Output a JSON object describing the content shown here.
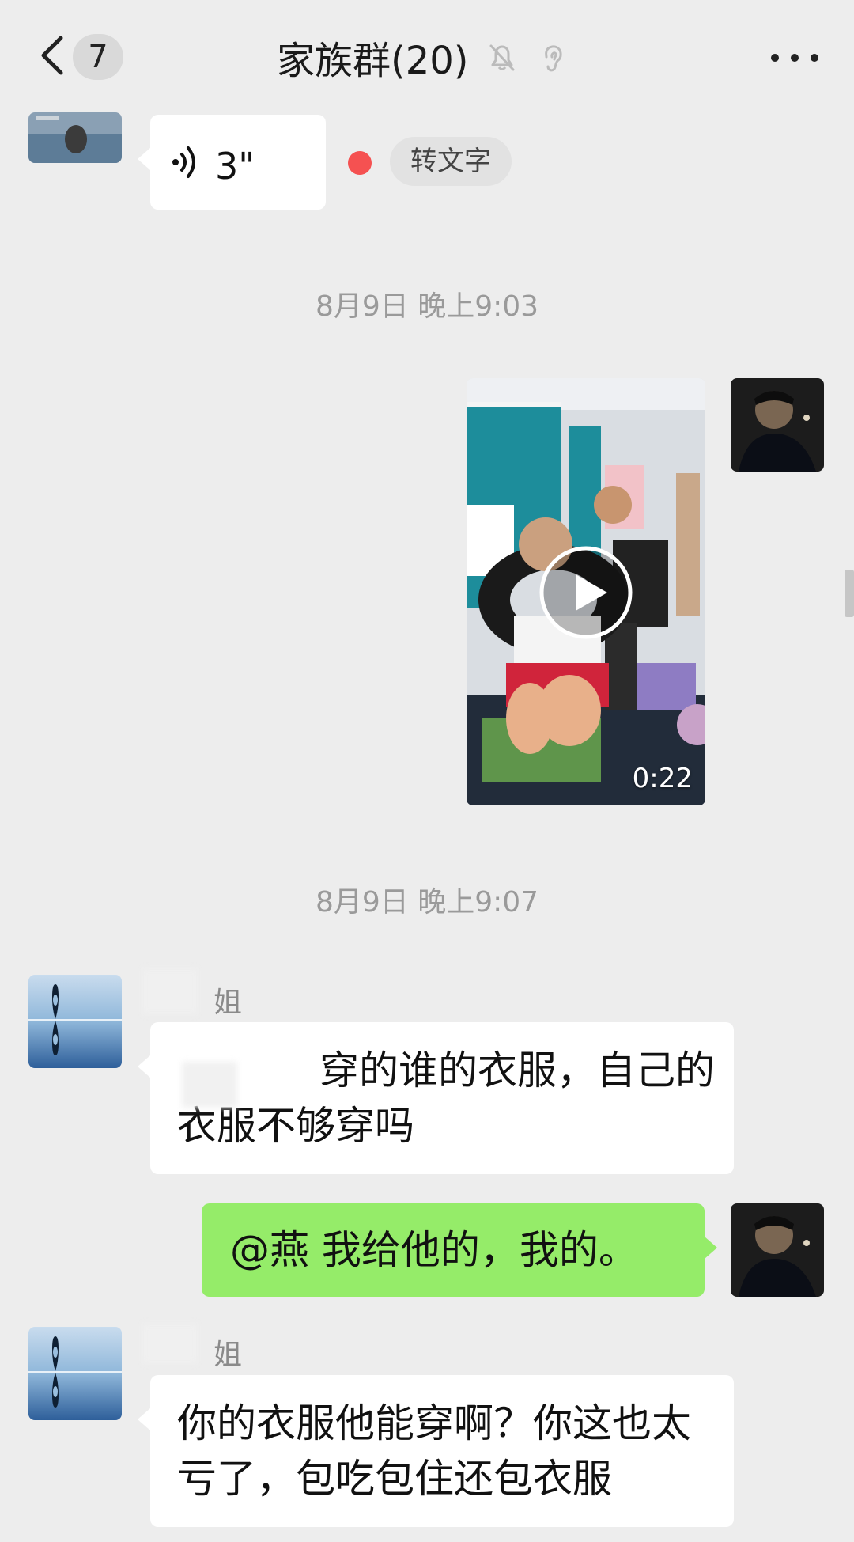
{
  "header": {
    "title": "家族群(20)",
    "unread_count": "7"
  },
  "messages": {
    "voice": {
      "duration": "3\"",
      "convert_label": "转文字"
    },
    "ts1": "8月9日 晚上9:03",
    "video": {
      "duration": "0:22"
    },
    "ts2": "8月9日 晚上9:07",
    "msg1": {
      "sender": "姐",
      "text": "穿的谁的衣服，自己的衣服不够穿吗"
    },
    "msg2": {
      "text": "@燕  我给他的，我的。"
    },
    "msg3": {
      "sender": "姐",
      "text": "你的衣服他能穿啊？你这也太亏了，包吃包住还包衣服"
    }
  },
  "icons": [
    "back-icon",
    "mute-bell-icon",
    "ear-icon",
    "more-icon",
    "voice-wave-icon",
    "play-icon"
  ],
  "colors": {
    "background": "#ededed",
    "self_bubble": "#95ec69",
    "unread_dot": "#f55151"
  }
}
